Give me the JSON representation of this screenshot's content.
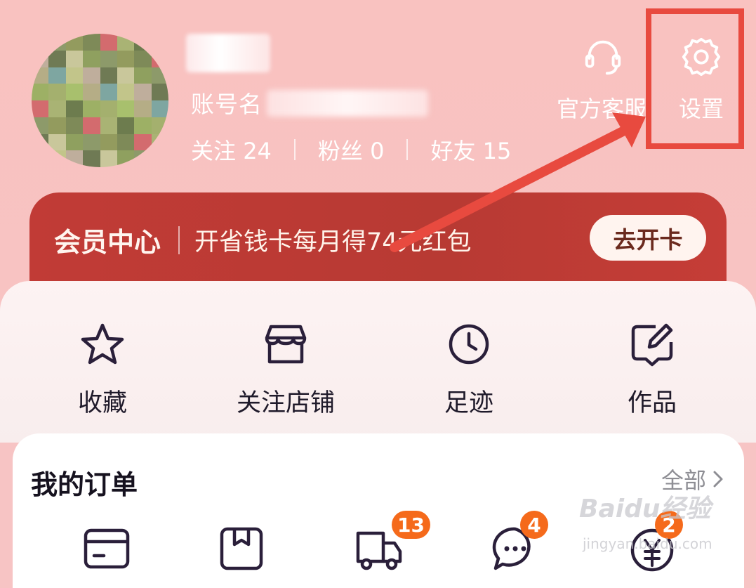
{
  "profile": {
    "account_label": "账号名",
    "stats": [
      {
        "label": "关注",
        "value": "24"
      },
      {
        "label": "粉丝",
        "value": "0"
      },
      {
        "label": "好友",
        "value": "15"
      }
    ]
  },
  "top_actions": {
    "service": {
      "label": "官方客服",
      "icon": "headset-icon"
    },
    "settings": {
      "label": "设置",
      "icon": "gear-icon"
    }
  },
  "member": {
    "title": "会员中心",
    "text": "开省钱卡每月得74元红包",
    "button": "去开卡"
  },
  "quick_links": [
    {
      "label": "收藏",
      "icon": "star-icon"
    },
    {
      "label": "关注店铺",
      "icon": "store-icon"
    },
    {
      "label": "足迹",
      "icon": "clock-icon"
    },
    {
      "label": "作品",
      "icon": "edit-note-icon"
    }
  ],
  "orders": {
    "title": "我的订单",
    "all_label": "全部",
    "badges": [
      "13",
      "4",
      "2"
    ]
  },
  "watermark": {
    "brand": "Baidu经验",
    "url": "jingyan.baidu.com"
  },
  "colors": {
    "header_bg": "#f8c3c2",
    "member_bg": "#bd3a34",
    "highlight": "#e84a3f",
    "badge": "#f56a1b",
    "icon_stroke": "#2a1f3a"
  }
}
